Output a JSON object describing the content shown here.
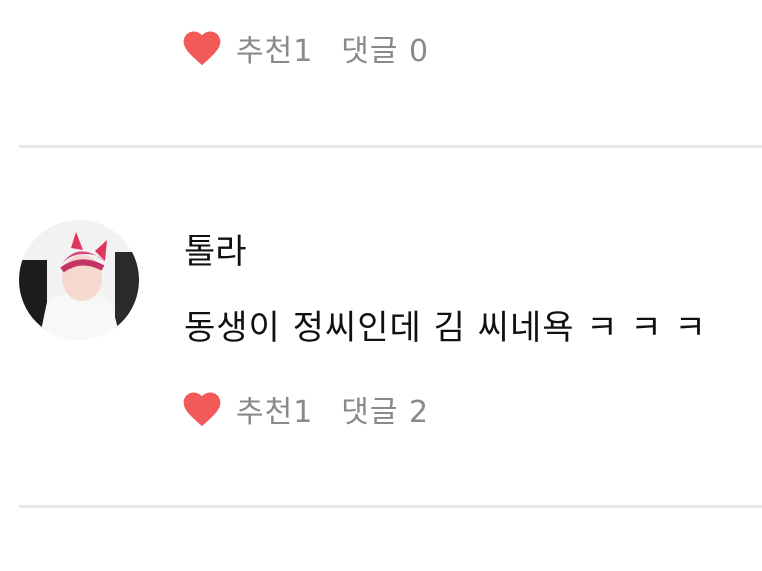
{
  "posts": [
    {
      "likes_label": "추천1",
      "comments_label": "댓글 0"
    },
    {
      "author": "톨라",
      "content": "동생이 정씨인데 김 씨네욕 ㅋ ㅋ ㅋ",
      "likes_label": "추천1",
      "comments_label": "댓글 2"
    }
  ],
  "icons": {
    "like": "heart-icon"
  },
  "colors": {
    "heart": "#f25a5a",
    "muted_text": "#8a8a8a",
    "divider": "#e7e7e7"
  }
}
